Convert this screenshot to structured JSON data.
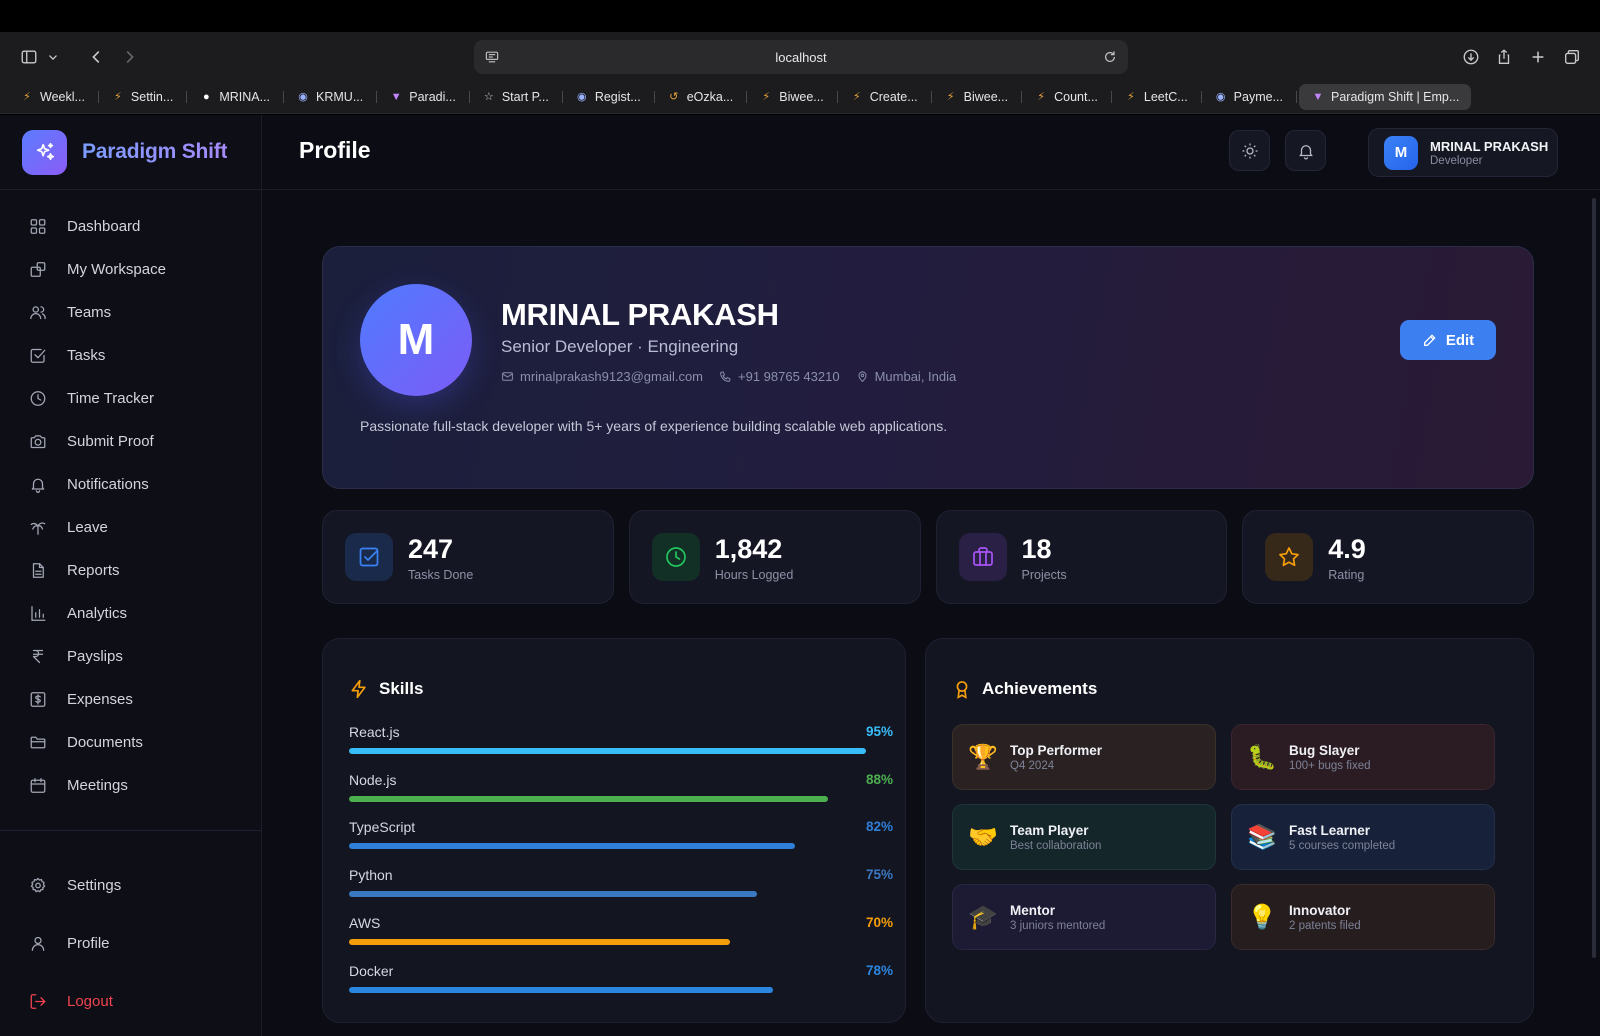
{
  "browser": {
    "url": "localhost",
    "tabs": [
      {
        "label": "Weekl...",
        "icon": "⚡",
        "color": "#e6a23c"
      },
      {
        "label": "Settin...",
        "icon": "⚡",
        "color": "#e6a23c"
      },
      {
        "label": "MRINA...",
        "icon": "●",
        "color": "#ffffff"
      },
      {
        "label": "KRMU...",
        "icon": "◉",
        "color": "#9bb3ff"
      },
      {
        "label": "Paradi...",
        "icon": "▼",
        "color": "#c084fc"
      },
      {
        "label": "Start P...",
        "icon": "☆",
        "color": "#d0d0d0"
      },
      {
        "label": "Regist...",
        "icon": "◉",
        "color": "#9bb3ff"
      },
      {
        "label": "eOzka...",
        "icon": "↺",
        "color": "#e6a23c"
      },
      {
        "label": "Biwee...",
        "icon": "⚡",
        "color": "#e6a23c"
      },
      {
        "label": "Create...",
        "icon": "⚡",
        "color": "#e6a23c"
      },
      {
        "label": "Biwee...",
        "icon": "⚡",
        "color": "#e6a23c"
      },
      {
        "label": "Count...",
        "icon": "⚡",
        "color": "#e6a23c"
      },
      {
        "label": "LeetC...",
        "icon": "⚡",
        "color": "#e6a23c"
      },
      {
        "label": "Payme...",
        "icon": "◉",
        "color": "#9bb3ff"
      },
      {
        "label": "Paradigm Shift | Emp...",
        "icon": "▼",
        "color": "#c084fc",
        "active": true
      }
    ]
  },
  "brand": {
    "name": "Paradigm Shift"
  },
  "sidebar": {
    "items": [
      {
        "label": "Dashboard",
        "icon": "grid-icon"
      },
      {
        "label": "My Workspace",
        "icon": "workspace-icon"
      },
      {
        "label": "Teams",
        "icon": "users-icon"
      },
      {
        "label": "Tasks",
        "icon": "checkbox-icon"
      },
      {
        "label": "Time Tracker",
        "icon": "clock-icon"
      },
      {
        "label": "Submit Proof",
        "icon": "camera-icon"
      },
      {
        "label": "Notifications",
        "icon": "bell-icon"
      },
      {
        "label": "Leave",
        "icon": "palm-tree-icon"
      },
      {
        "label": "Reports",
        "icon": "file-text-icon"
      },
      {
        "label": "Analytics",
        "icon": "bar-chart-icon"
      },
      {
        "label": "Payslips",
        "icon": "rupee-icon"
      },
      {
        "label": "Expenses",
        "icon": "dollar-icon"
      },
      {
        "label": "Documents",
        "icon": "folder-icon"
      },
      {
        "label": "Meetings",
        "icon": "calendar-icon"
      }
    ],
    "bottom": [
      {
        "label": "Settings",
        "icon": "gear-icon"
      },
      {
        "label": "Profile",
        "icon": "user-icon"
      },
      {
        "label": "Logout",
        "icon": "logout-icon"
      }
    ]
  },
  "header": {
    "title": "Profile",
    "user": {
      "initial": "M",
      "name": "MRINAL PRAKASH",
      "role": "Developer"
    }
  },
  "profile": {
    "initial": "M",
    "name": "MRINAL PRAKASH",
    "role": "Senior Developer · Engineering",
    "email": "mrinalprakash9123@gmail.com",
    "phone": "+91 98765 43210",
    "location": "Mumbai, India",
    "bio": "Passionate full-stack developer with 5+ years of experience building scalable web applications.",
    "edit_label": "Edit"
  },
  "stats": [
    {
      "value": "247",
      "label": "Tasks Done",
      "icon": "check-square-icon",
      "color": "#3b82f6",
      "bg": "#1a2a4a"
    },
    {
      "value": "1,842",
      "label": "Hours Logged",
      "icon": "clock-icon",
      "color": "#22c55e",
      "bg": "#123026"
    },
    {
      "value": "18",
      "label": "Projects",
      "icon": "briefcase-icon",
      "color": "#a855f7",
      "bg": "#2a1f45"
    },
    {
      "value": "4.9",
      "label": "Rating",
      "icon": "star-icon",
      "color": "#f59e0b",
      "bg": "#36291a"
    }
  ],
  "skills": {
    "title": "Skills",
    "items": [
      {
        "name": "React.js",
        "pct": 95,
        "label": "95%",
        "color": "#38bdf8"
      },
      {
        "name": "Node.js",
        "pct": 88,
        "label": "88%",
        "color": "#4caf50"
      },
      {
        "name": "TypeScript",
        "pct": 82,
        "label": "82%",
        "color": "#2f7ed8"
      },
      {
        "name": "Python",
        "pct": 75,
        "label": "75%",
        "color": "#3a78c2"
      },
      {
        "name": "AWS",
        "pct": 70,
        "label": "70%",
        "color": "#f59e0b"
      },
      {
        "name": "Docker",
        "pct": 78,
        "label": "78%",
        "color": "#2b86e0"
      }
    ]
  },
  "achievements": {
    "title": "Achievements",
    "items": [
      {
        "title": "Top Performer",
        "sub": "Q4 2024",
        "emoji": "🏆",
        "bg": "#2a2222",
        "border": "#3a302a"
      },
      {
        "title": "Bug Slayer",
        "sub": "100+ bugs fixed",
        "emoji": "🐛",
        "bg": "#2a1c22",
        "border": "#3a2530"
      },
      {
        "title": "Team Player",
        "sub": "Best collaboration",
        "emoji": "🤝",
        "bg": "#14262a",
        "border": "#1e363a"
      },
      {
        "title": "Fast Learner",
        "sub": "5 courses completed",
        "emoji": "📚",
        "bg": "#17223a",
        "border": "#22304a"
      },
      {
        "title": "Mentor",
        "sub": "3 juniors mentored",
        "emoji": "🎓",
        "bg": "#1d1a33",
        "border": "#2a2645"
      },
      {
        "title": "Innovator",
        "sub": "2 patents filed",
        "emoji": "💡",
        "bg": "#261d1f",
        "border": "#3a2a2a"
      }
    ]
  }
}
